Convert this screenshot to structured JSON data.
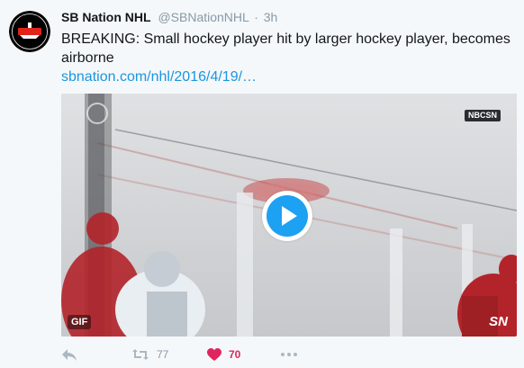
{
  "tweet": {
    "display_name": "SB Nation NHL",
    "handle": "@SBNationNHL",
    "separator": "·",
    "time": "3h",
    "text": "BREAKING: Small hockey player hit by larger hockey player, becomes airborne",
    "link": "sbnation.com/nhl/2016/4/19/…"
  },
  "media": {
    "type": "gif",
    "gif_label": "GIF",
    "broadcaster_badge": "NBCSN",
    "corner_bug": "SN",
    "play_icon": "play-icon"
  },
  "actions": {
    "reply_icon": "reply-icon",
    "retweet_icon": "retweet-icon",
    "retweet_count": "77",
    "like_icon": "heart-icon",
    "like_count": "70",
    "more_icon": "more-icon"
  },
  "colors": {
    "background": "#f5f8fa",
    "link": "#1b95e0",
    "play_button": "#1da1f2",
    "like_active": "#e0245e",
    "muted": "#8899a6",
    "avatar_red": "#e2231a"
  }
}
